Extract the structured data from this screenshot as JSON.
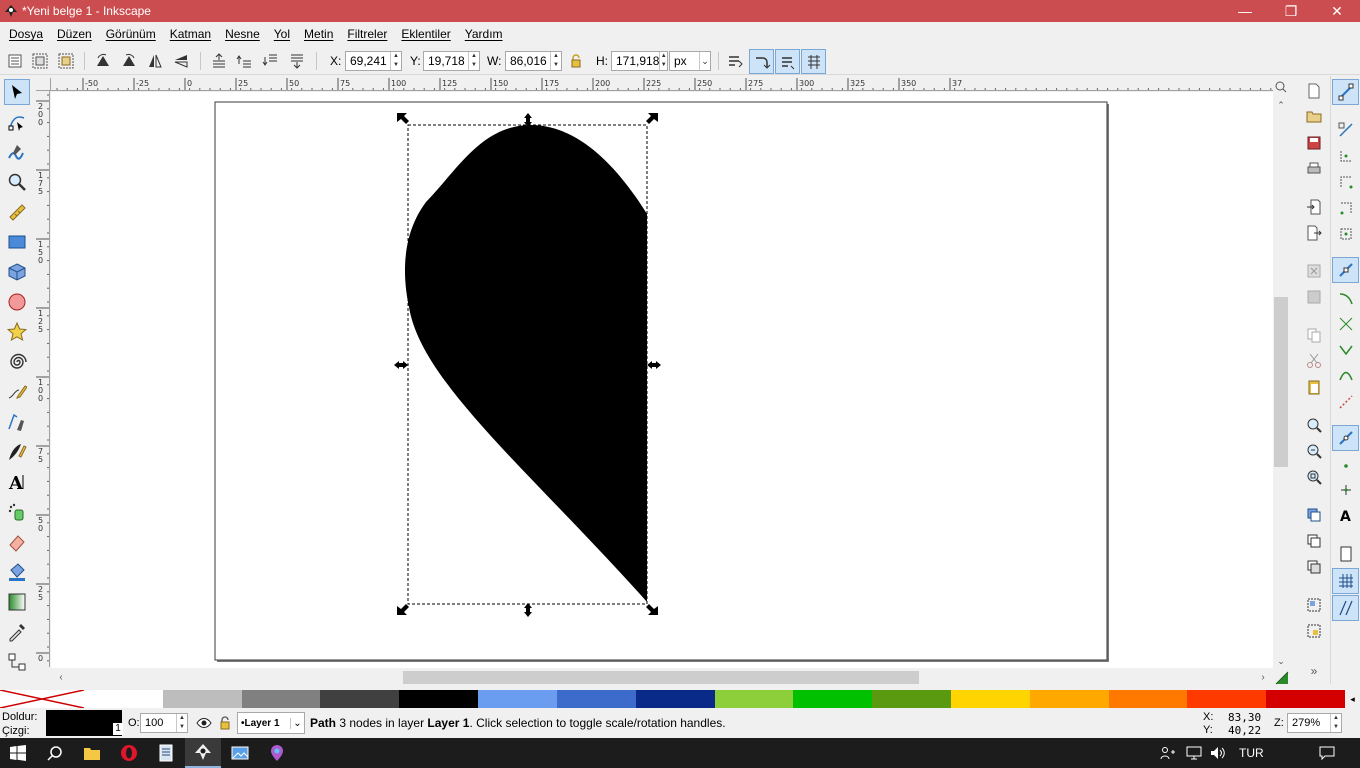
{
  "window": {
    "title": "*Yeni belge 1 - Inkscape",
    "minimize_label": "—",
    "maximize_label": "❐",
    "close_label": "✕"
  },
  "menu": [
    "Dosya",
    "Düzen",
    "Görünüm",
    "Katman",
    "Nesne",
    "Yol",
    "Metin",
    "Filtreler",
    "Eklentiler",
    "Yardım"
  ],
  "toolbar": {
    "x_label": "X:",
    "x_value": "69,241",
    "y_label": "Y:",
    "y_value": "19,718",
    "w_label": "W:",
    "w_value": "86,016",
    "h_label": "H:",
    "h_value": "171,918",
    "unit": "px"
  },
  "rulers": {
    "horizontal": [
      "-50",
      "-25",
      "0",
      "25",
      "50",
      "75",
      "100",
      "125",
      "150",
      "175",
      "200",
      "225",
      "250",
      "275",
      "300",
      "325",
      "350",
      "37"
    ],
    "vertical": [
      "2\n0\n0",
      "1\n7\n5",
      "1\n5\n0",
      "1\n2\n5",
      "1\n0\n0",
      "7\n5",
      "5\n0",
      "2\n5",
      "0"
    ]
  },
  "palette": {
    "colors": [
      "#ffffff",
      "#bdbdbd",
      "#808080",
      "#404040",
      "#000000",
      "#6a9cf0",
      "#3d6bcb",
      "#0a2a8a",
      "#8ccf3a",
      "#00c000",
      "#5a9a10",
      "#ffd400",
      "#ffa800",
      "#ff7800",
      "#ff3a00",
      "#d40000"
    ]
  },
  "status": {
    "fill_label": "Doldur:",
    "stroke_label": "Çizgi:",
    "stroke_width": "1",
    "opacity_label": "O:",
    "opacity_value": "100",
    "layer_name": "•Layer 1",
    "message_bold": "Path",
    "message_mid": " 3 nodes in layer ",
    "message_layer": "Layer 1",
    "message_end": ". Click selection to toggle scale/rotation handles.",
    "cursor_x_label": "X:",
    "cursor_x": "83,30",
    "cursor_y_label": "Y:",
    "cursor_y": "40,22",
    "zoom_label": "Z:",
    "zoom_value": "279%"
  },
  "taskbar": {
    "language": "TUR"
  },
  "colors": {
    "titlebar": "#cc4d4f",
    "selection_toggle": "#cde3f7",
    "accent": "#2a74c4"
  }
}
